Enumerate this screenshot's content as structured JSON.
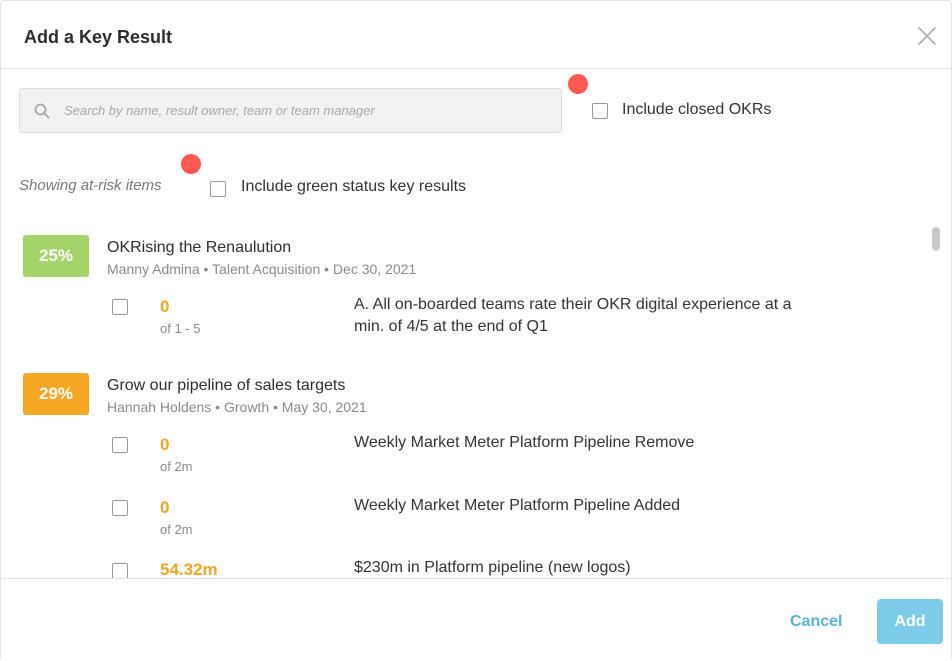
{
  "dialog": {
    "title": "Add a Key Result"
  },
  "search": {
    "placeholder": "Search by name, result owner, team or team manager"
  },
  "filters": {
    "include_closed_label": "Include closed OKRs",
    "include_green_label": "Include green status key results",
    "showing_label": "Showing at-risk items"
  },
  "objectives": [
    {
      "progress": "25%",
      "badge_color": "#a4d36a",
      "title": "OKRising the Renaulution",
      "owner": "Manny Admina",
      "team": "Talent Acquisition",
      "date": "Dec 30, 2021",
      "key_results": [
        {
          "value": "0",
          "target": "of 1 - 5",
          "name": "A. All on-boarded teams rate their OKR digital experience at a min. of 4/5 at the end of Q1"
        }
      ]
    },
    {
      "progress": "29%",
      "badge_color": "#f5a623",
      "title": "Grow our pipeline of sales targets",
      "owner": "Hannah Holdens",
      "team": "Growth",
      "date": "May 30, 2021",
      "key_results": [
        {
          "value": "0",
          "target": "of 2m",
          "name": "Weekly Market Meter Platform Pipeline Remove"
        },
        {
          "value": "0",
          "target": "of 2m",
          "name": "Weekly Market Meter Platform Pipeline Added"
        },
        {
          "value": "54.32m",
          "target": "",
          "name": "$230m in Platform pipeline (new logos)"
        }
      ]
    }
  ],
  "footer": {
    "cancel_label": "Cancel",
    "add_label": "Add"
  },
  "colors": {
    "accent": "#56b3de",
    "add_button": "#7ccbe9",
    "value": "#f5a623",
    "indicator_dot": "#ff5a52"
  }
}
